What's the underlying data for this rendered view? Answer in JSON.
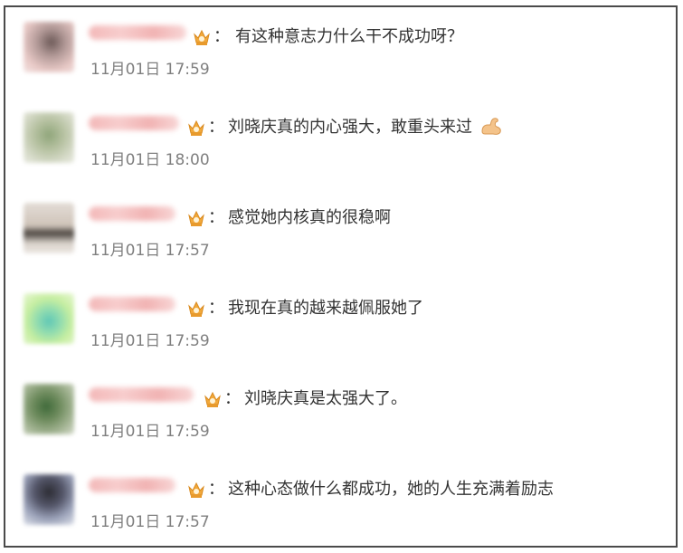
{
  "comments": [
    {
      "text": "有这种意志力什么干不成功呀？",
      "time": "11月01日 17:59",
      "has_emoji": false
    },
    {
      "text": "刘晓庆真的内心强大，敢重头来过",
      "time": "11月01日 18:00",
      "has_emoji": true,
      "emoji": "flexed-biceps"
    },
    {
      "text": "感觉她内核真的很稳啊",
      "time": "11月01日 17:57",
      "has_emoji": false
    },
    {
      "text": "我现在真的越来越佩服她了",
      "time": "11月01日 17:59",
      "has_emoji": false
    },
    {
      "text": "刘晓庆真是太强大了。",
      "time": "11月01日 17:59",
      "has_emoji": false
    },
    {
      "text": "这种心态做什么都成功，她的人生充满着励志",
      "time": "11月01日 17:57",
      "has_emoji": false
    }
  ],
  "colon": "：",
  "icons": {
    "badge": "crown-badge-icon"
  },
  "colors": {
    "text": "#333333",
    "time": "#7f7f7f",
    "badge_gold": "#f2a93b",
    "border": "#4a4a4a"
  }
}
